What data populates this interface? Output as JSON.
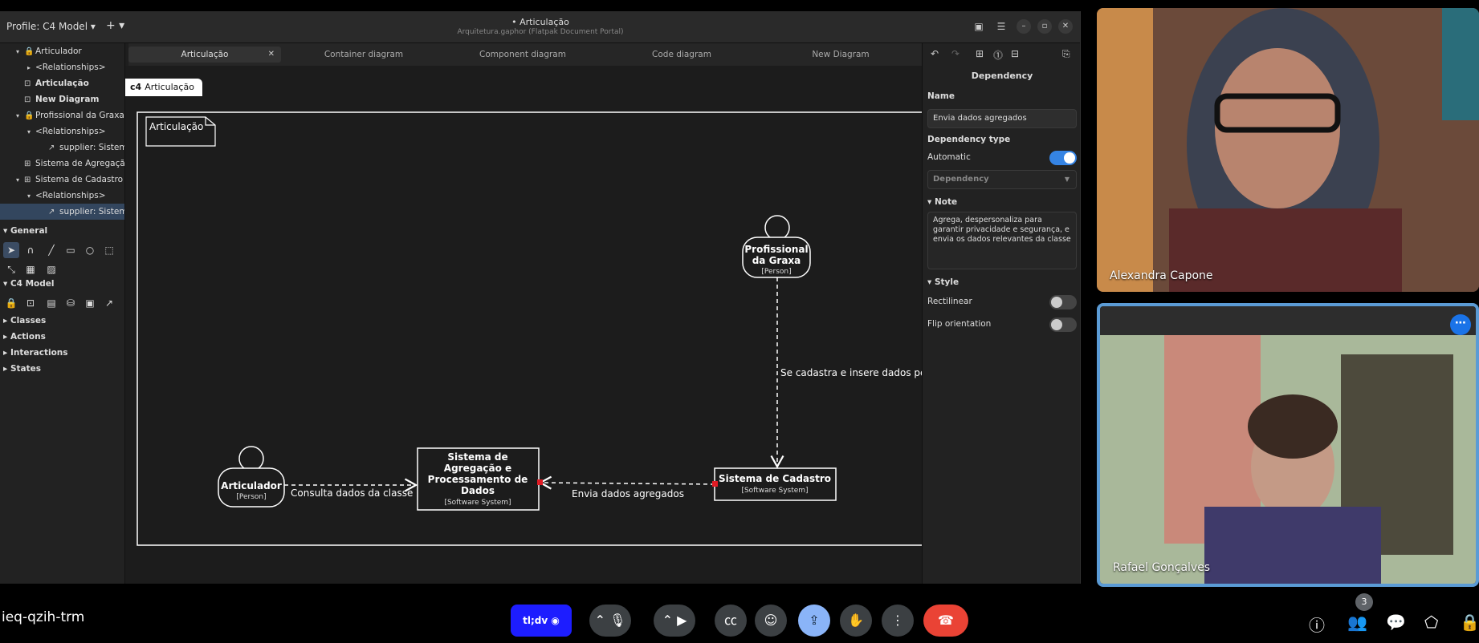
{
  "window": {
    "profile_label": "Profile: C4 Model ▾",
    "add_label": "+ ▾",
    "title": "• Articulação",
    "subtitle": "Arquitetura.gaphor (Flatpak Document Portal)"
  },
  "tree": {
    "items": [
      {
        "label": "Articulador",
        "arrow": "▾",
        "icon": "🔒"
      },
      {
        "label": "<Relationships>",
        "arrow": "▸",
        "icon": ""
      },
      {
        "label": "Articulação",
        "arrow": "",
        "icon": "⊡"
      },
      {
        "label": "New Diagram",
        "arrow": "",
        "icon": "⊡"
      },
      {
        "label": "Profissional da Graxa",
        "arrow": "▾",
        "icon": "🔒"
      },
      {
        "label": "<Relationships>",
        "arrow": "▾",
        "icon": ""
      },
      {
        "label": "supplier: Sistema",
        "arrow": "",
        "icon": "↗"
      },
      {
        "label": "Sistema de Agregação",
        "arrow": "",
        "icon": "⊞"
      },
      {
        "label": "Sistema de Cadastro",
        "arrow": "▾",
        "icon": "⊞"
      },
      {
        "label": "<Relationships>",
        "arrow": "▾",
        "icon": ""
      },
      {
        "label": "supplier: Sistema",
        "arrow": "",
        "icon": "↗"
      }
    ]
  },
  "toolbox": {
    "general": "General",
    "c4model": "C4 Model",
    "classes": "Classes",
    "actions": "Actions",
    "interactions": "Interactions",
    "states": "States"
  },
  "tabs": [
    {
      "label": "Articulação",
      "active": true
    },
    {
      "label": "Container diagram"
    },
    {
      "label": "Component diagram"
    },
    {
      "label": "Code diagram"
    },
    {
      "label": "New Diagram"
    }
  ],
  "canvas": {
    "crumb_type": "c4",
    "crumb_label": "Articulação",
    "frame_label": "Articulação",
    "persons": {
      "profissional": {
        "line1": "Profissional",
        "line2": "da Graxa",
        "stereo": "[Person]"
      },
      "articulador": {
        "line1": "Articulador",
        "stereo": "[Person]"
      }
    },
    "systems": {
      "agregacao": {
        "lines": [
          "Sistema de",
          "Agregação e",
          "Processamento de",
          "Dados"
        ],
        "stereo": "[Software System]"
      },
      "cadastro": {
        "line1": "Sistema de Cadastro",
        "stereo": "[Software System]"
      }
    },
    "edges": {
      "cadastra": "Se cadastra e insere dados pe",
      "consulta": "Consulta dados da classe",
      "envia": "Envia dados agregados"
    }
  },
  "props": {
    "title": "Dependency",
    "name_label": "Name",
    "name_value": "Envia dados agregados",
    "dep_type_label": "Dependency type",
    "automatic_label": "Automatic",
    "automatic_on": true,
    "dep_dropdown": "Dependency",
    "note_label": "Note",
    "note_text": "Agrega, despersonaliza para garantir privacidade e segurança, e envia os dados relevantes da classe",
    "style_label": "Style",
    "rectilinear_label": "Rectilinear",
    "flip_label": "Flip orientation"
  },
  "meet": {
    "code": "ieq-qzih-trm",
    "screen_label": "tl;dv",
    "participants_count": "3",
    "tiles": [
      {
        "name": "Alexandra Capone"
      },
      {
        "name": "Rafael Gonçalves"
      }
    ]
  },
  "colors": {
    "accent": "#3584e4",
    "end_call": "#ea4335",
    "tile_border": "#5b9bd5"
  }
}
